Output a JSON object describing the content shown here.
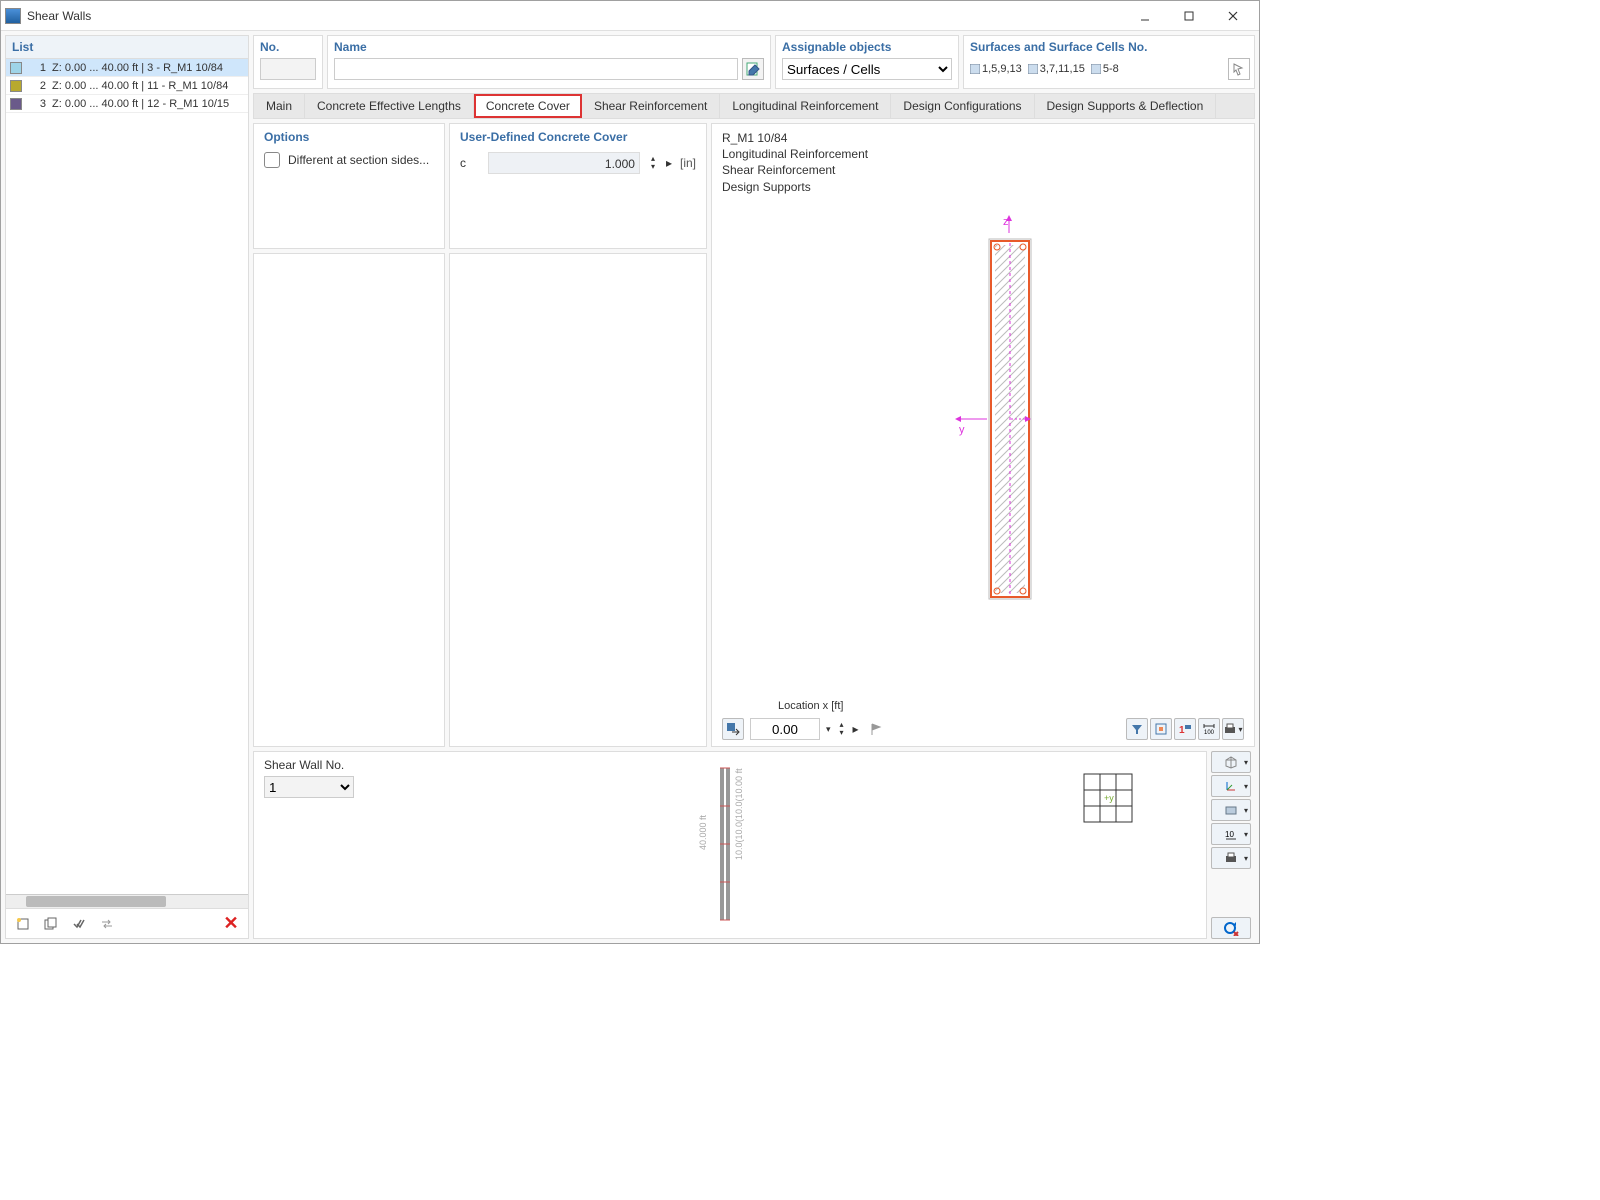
{
  "window": {
    "title": "Shear Walls"
  },
  "list": {
    "header": "List",
    "items": [
      {
        "num": "1",
        "text": "Z: 0.00 ... 40.00 ft | 3 - R_M1 10/84",
        "color": "#9ed4e8",
        "selected": true
      },
      {
        "num": "2",
        "text": "Z: 0.00 ... 40.00 ft | 11 - R_M1 10/84",
        "color": "#b8a92e",
        "selected": false
      },
      {
        "num": "3",
        "text": "Z: 0.00 ... 40.00 ft | 12 - R_M1 10/15",
        "color": "#6a5a8a",
        "selected": false
      }
    ]
  },
  "fields": {
    "no_label": "No.",
    "no_value": "",
    "name_label": "Name",
    "name_value": "",
    "assign_label": "Assignable objects",
    "assign_value": "Surfaces / Cells",
    "surf_label": "Surfaces and Surface Cells No.",
    "surf_groups": [
      "1,5,9,13",
      "3,7,11,15",
      "5-8"
    ]
  },
  "tabs": {
    "items": [
      "Main",
      "Concrete Effective Lengths",
      "Concrete Cover",
      "Shear Reinforcement",
      "Longitudinal Reinforcement",
      "Design Configurations",
      "Design Supports & Deflection"
    ],
    "active": 2
  },
  "options": {
    "title": "Options",
    "diff_label": "Different at section sides..."
  },
  "cover": {
    "title": "User-Defined Concrete Cover",
    "param": "c",
    "value": "1.000",
    "unit": "[in]"
  },
  "preview": {
    "lines": [
      "R_M1 10/84",
      "Longitudinal Reinforcement",
      "Shear Reinforcement",
      "Design Supports"
    ],
    "axis_z": "z",
    "axis_y": "y",
    "loc_label": "Location x [ft]",
    "loc_value": "0.00"
  },
  "bottom": {
    "label": "Shear Wall No.",
    "value": "1",
    "dim_long": "40.000 ft",
    "dim_seg": "10.0(10.0(10.0(10.00 ft"
  }
}
